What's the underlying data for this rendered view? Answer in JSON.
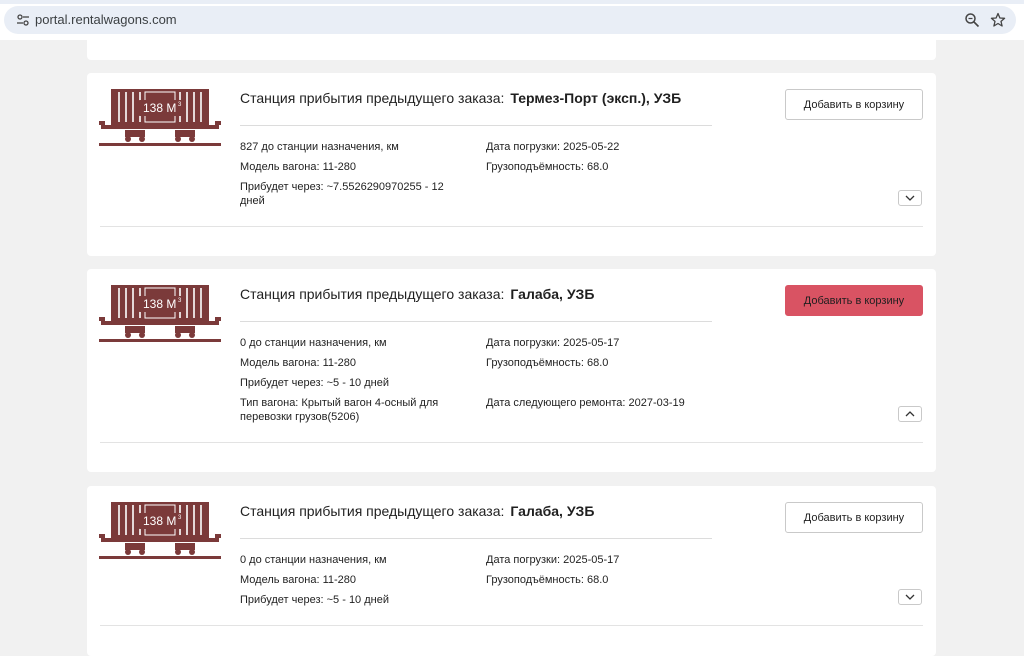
{
  "browser": {
    "url": "portal.rentalwagons.com",
    "icons": [
      "site-info-icon",
      "zoom-icon",
      "star-icon"
    ]
  },
  "wagon_image": {
    "volume_label": "138 М",
    "superscript": "3",
    "color": "#7b3a3a"
  },
  "colors": {
    "accent_button": "#d95363",
    "wagon": "#7b3a3a",
    "page_bg": "#f1f1f1"
  },
  "cards": [
    {
      "station_label": "Станция прибытия предыдущего заказа:",
      "station_name": "Термез-Порт (эксп.), УЗБ",
      "add_button": "Добавить в корзину",
      "add_button_active": false,
      "expanded": false,
      "distance": "827 до станции назначения, км",
      "model": "Модель вагона: 11-280",
      "arrival": "Прибудет через: ~7.5526290970255 - 12 дней",
      "loading_date": "Дата погрузки: 2025-05-22",
      "capacity": "Грузоподъёмность: 68.0"
    },
    {
      "station_label": "Станция прибытия предыдущего заказа:",
      "station_name": "Галаба, УЗБ",
      "add_button": "Добавить в корзину",
      "add_button_active": true,
      "expanded": true,
      "distance": "0 до станции назначения, км",
      "model": "Модель вагона: 11-280",
      "arrival": "Прибудет через: ~5 - 10 дней",
      "wagon_type": "Тип вагона: Крытый вагон 4-осный для перевозки грузов(5206)",
      "loading_date": "Дата погрузки: 2025-05-17",
      "capacity": "Грузоподъёмность: 68.0",
      "next_repair": "Дата следующего ремонта: 2027-03-19"
    },
    {
      "station_label": "Станция прибытия предыдущего заказа:",
      "station_name": "Галаба, УЗБ",
      "add_button": "Добавить в корзину",
      "add_button_active": false,
      "expanded": false,
      "distance": "0 до станции назначения, км",
      "model": "Модель вагона: 11-280",
      "arrival": "Прибудет через: ~5 - 10 дней",
      "loading_date": "Дата погрузки: 2025-05-17",
      "capacity": "Грузоподъёмность: 68.0"
    }
  ]
}
